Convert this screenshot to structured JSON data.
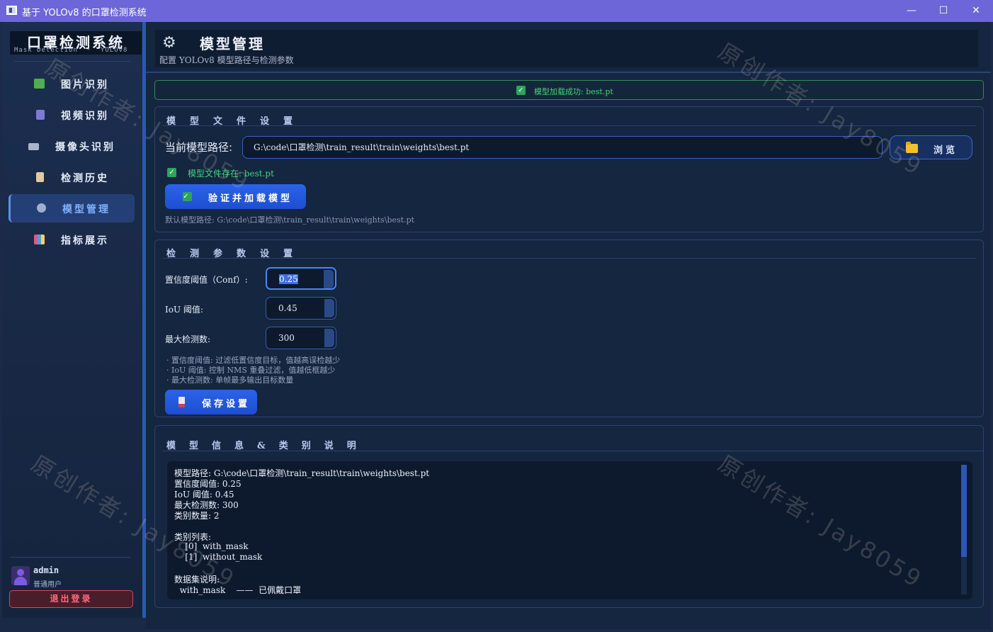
{
  "window": {
    "title": "基于 YOLOv8 的口罩检测系统",
    "minimize": "—",
    "maximize": "☐",
    "close": "✕"
  },
  "sidebar": {
    "logo_title": "口罩检测系统",
    "logo_subtitle": "Mask Detection  ·  YOLOv8",
    "items": [
      {
        "label": "图片识别",
        "icon": "image-icon",
        "color": "#4caf50"
      },
      {
        "label": "视频识别",
        "icon": "film-clapper-icon",
        "color": "#7d7ad6"
      },
      {
        "label": "摄像头识别",
        "icon": "camera-icon",
        "color": "#aab4c8"
      },
      {
        "label": "检测历史",
        "icon": "clipboard-icon",
        "color": "#e2c9a0"
      },
      {
        "label": "模型管理",
        "icon": "gear-icon",
        "color": "#9fb0cf",
        "active": true
      },
      {
        "label": "指标展示",
        "icon": "bar-chart-icon",
        "color": "#e05b7a"
      }
    ],
    "user": {
      "name": "admin",
      "role": "普通用户"
    },
    "logout_label": "退出登录"
  },
  "header": {
    "title": "模型管理",
    "subtitle": "配置 YOLOv8 模型路径与检测参数"
  },
  "status": {
    "text": "模型加载成功: best.pt",
    "color": "#42d47a"
  },
  "model_file": {
    "group_title": "模型文件设置",
    "path_label": "当前模型路径:",
    "path_value": "G:\\code\\口罩检测\\train_result\\train\\weights\\best.pt",
    "browse_label": "浏览",
    "exists_text": "模型文件存在: best.pt",
    "verify_button": "验证并加载模型",
    "default_path_text": "默认模型路径: G:\\code\\口罩检测\\train_result\\train\\weights\\best.pt"
  },
  "detection": {
    "group_title": "检测参数设置",
    "conf_label": "置信度阈值（Conf）:",
    "conf_value": "0.25",
    "iou_label": "IoU 阈值:",
    "iou_value": "0.45",
    "max_label": "最大检测数:",
    "max_value": "300",
    "hints": [
      "·  置信度阈值: 过滤低置信度目标，值越高误检越少",
      "·  IoU 阈值: 控制 NMS 重叠过滤，值越低框越少",
      "·  最大检测数: 单帧最多输出目标数量"
    ],
    "save_button": "保存设置"
  },
  "info": {
    "group_title": "模型信息&类别说明",
    "lines": [
      "模型路径: G:\\code\\口罩检测\\train_result\\train\\weights\\best.pt",
      "置信度阈值: 0.25",
      "IoU 阈值: 0.45",
      "最大检测数: 300",
      "类别数量: 2",
      "",
      "类别列表:",
      "    [0]  with_mask",
      "    [1]  without_mask",
      "",
      "数据集说明:",
      "  with_mask    ——  已佩戴口罩"
    ]
  },
  "watermark": "原创作者: Jay8059",
  "colors": {
    "accent": "#2b63e8",
    "success": "#42d47a",
    "danger": "#ff6b80",
    "titlebar": "#6c66d8"
  }
}
